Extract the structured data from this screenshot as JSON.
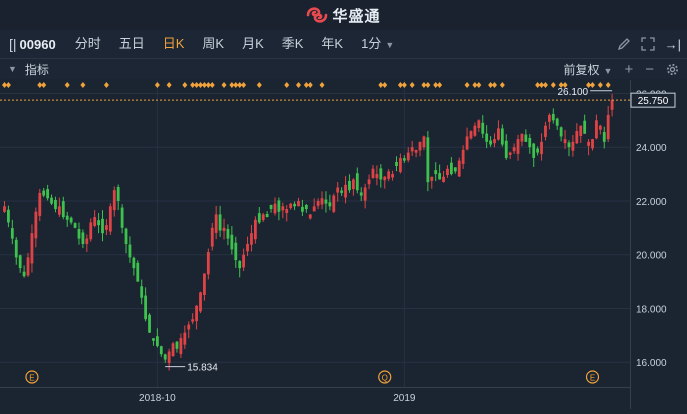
{
  "app": {
    "title": "华盛通"
  },
  "toolbar": {
    "stock_code": "00960",
    "tabs": [
      {
        "label": "分时",
        "active": false
      },
      {
        "label": "五日",
        "active": false
      },
      {
        "label": "日K",
        "active": true
      },
      {
        "label": "周K",
        "active": false
      },
      {
        "label": "月K",
        "active": false
      },
      {
        "label": "季K",
        "active": false
      },
      {
        "label": "年K",
        "active": false
      },
      {
        "label": "1分",
        "active": false
      }
    ]
  },
  "indicator_bar": {
    "label": "指标",
    "adjust_label": "前复权",
    "plus": "+",
    "minus": "−"
  },
  "colors": {
    "up": "#e04345",
    "down": "#3ec24e",
    "accent": "#f0a33a",
    "bg": "#1b2431",
    "grid": "#263142"
  },
  "chart_data": {
    "type": "candlestick",
    "y_ticks": [
      "26.000",
      "24.000",
      "22.000",
      "20.000",
      "18.000",
      "16.000"
    ],
    "y_tick_values": [
      26,
      24,
      22,
      20,
      18,
      16
    ],
    "ylim": [
      15.45,
      26.5
    ],
    "x_ticks": [
      {
        "label": "2018-10",
        "index": 39
      },
      {
        "label": "2019",
        "index": 102
      }
    ],
    "current_price": "25.750",
    "current_value": 25.75,
    "high_label": "26.100",
    "high_value": 26.1,
    "low_label": "15.834",
    "low_value": 15.834,
    "event_markers": [
      {
        "label": "E",
        "index": 7
      },
      {
        "label": "Q",
        "index": 97
      },
      {
        "label": "E",
        "index": 150
      }
    ],
    "closes": [
      21.8,
      21.2,
      20.6,
      19.9,
      19.5,
      19.2,
      19.9,
      20.8,
      21.6,
      22.3,
      22.2,
      22.1,
      21.9,
      21.7,
      21.8,
      21.4,
      21.3,
      21.2,
      21.0,
      20.6,
      20.4,
      20.6,
      21.2,
      21.4,
      21.1,
      20.8,
      21.1,
      21.8,
      22.4,
      22.0,
      21.0,
      20.4,
      19.9,
      19.5,
      19.0,
      18.4,
      17.6,
      17.1,
      16.8,
      16.6,
      16.3,
      16.1,
      16.4,
      16.7,
      16.5,
      16.9,
      17.1,
      17.4,
      17.6,
      18.1,
      18.6,
      19.3,
      20.1,
      21.0,
      21.5,
      20.9,
      21.0,
      20.6,
      20.2,
      19.8,
      19.5,
      20.0,
      20.4,
      20.8,
      21.3,
      21.2,
      21.5,
      21.4,
      21.7,
      21.9,
      21.6,
      21.8,
      21.7,
      21.9,
      21.8,
      22.0,
      21.6,
      21.7,
      21.5,
      21.8,
      22.0,
      22.1,
      21.9,
      21.8,
      22.2,
      22.5,
      22.3,
      22.6,
      22.4,
      22.8,
      22.4,
      22.2,
      22.5,
      22.8,
      23.2,
      23.0,
      22.8,
      22.9,
      23.1,
      23.0,
      23.3,
      23.6,
      23.5,
      23.8,
      24.0,
      23.9,
      24.2,
      24.4,
      22.7,
      22.9,
      23.0,
      22.8,
      22.9,
      23.2,
      23.0,
      23.1,
      23.5,
      23.9,
      24.4,
      24.6,
      24.8,
      25.0,
      24.5,
      24.2,
      24.1,
      24.3,
      24.7,
      24.1,
      23.6,
      23.8,
      24.0,
      24.3,
      24.5,
      24.2,
      24.0,
      23.6,
      23.8,
      24.2,
      24.8,
      25.2,
      25.0,
      24.8,
      24.4,
      24.3,
      24.0,
      24.2,
      24.6,
      24.8,
      24.5,
      24.2,
      24.3,
      25.0,
      24.8,
      24.2,
      25.2,
      25.75
    ]
  }
}
